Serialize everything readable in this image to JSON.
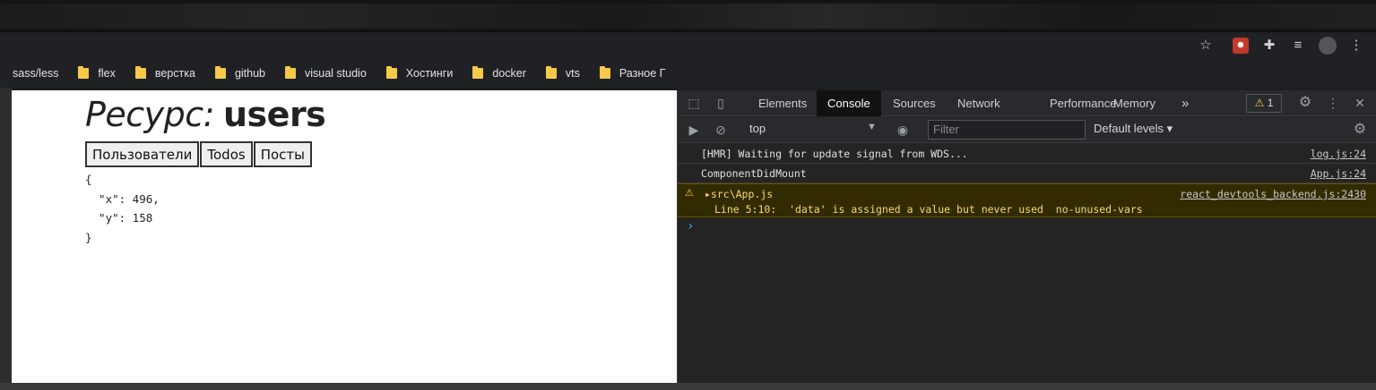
{
  "browser": {
    "bookmarks": [
      {
        "label": "sass/less",
        "folder": false
      },
      {
        "label": "flex",
        "folder": true
      },
      {
        "label": "верстка",
        "folder": true
      },
      {
        "label": "github",
        "folder": true
      },
      {
        "label": "visual studio",
        "folder": true
      },
      {
        "label": "Хостинги",
        "folder": true
      },
      {
        "label": "docker",
        "folder": true
      },
      {
        "label": "vts",
        "folder": true
      },
      {
        "label": "Разное Г",
        "folder": true
      }
    ],
    "toolbar_icons": [
      "star-icon",
      "extension-red-icon",
      "puzzle-icon",
      "media-queue-icon",
      "profile-avatar",
      "menu-dots-icon"
    ]
  },
  "page": {
    "heading_label": "Ресурс:",
    "heading_value": "users",
    "buttons": [
      "Пользователи",
      "Todos",
      "Посты"
    ],
    "json_lines": [
      "{",
      "  \"x\": 496,",
      "  \"y\": 158",
      "}"
    ]
  },
  "devtools": {
    "tabs": [
      "Elements",
      "Console",
      "Sources",
      "Network",
      "Performance",
      "Memory"
    ],
    "active_tab": "Console",
    "more_tabs": "»",
    "warning_count": "1",
    "context": "top",
    "filter_placeholder": "Filter",
    "levels": "Default levels ▾",
    "logs": [
      {
        "message": "[HMR] Waiting for update signal from WDS...",
        "source": "log.js:24"
      },
      {
        "message": "ComponentDidMount",
        "source": "App.js:24"
      },
      {
        "message": "src\\App.js",
        "source": "react_devtools_backend.js:2430",
        "detail": "Line 5:10:  'data' is assigned a value but never used  no-unused-vars",
        "level": "warning"
      }
    ],
    "prompt": "›"
  }
}
